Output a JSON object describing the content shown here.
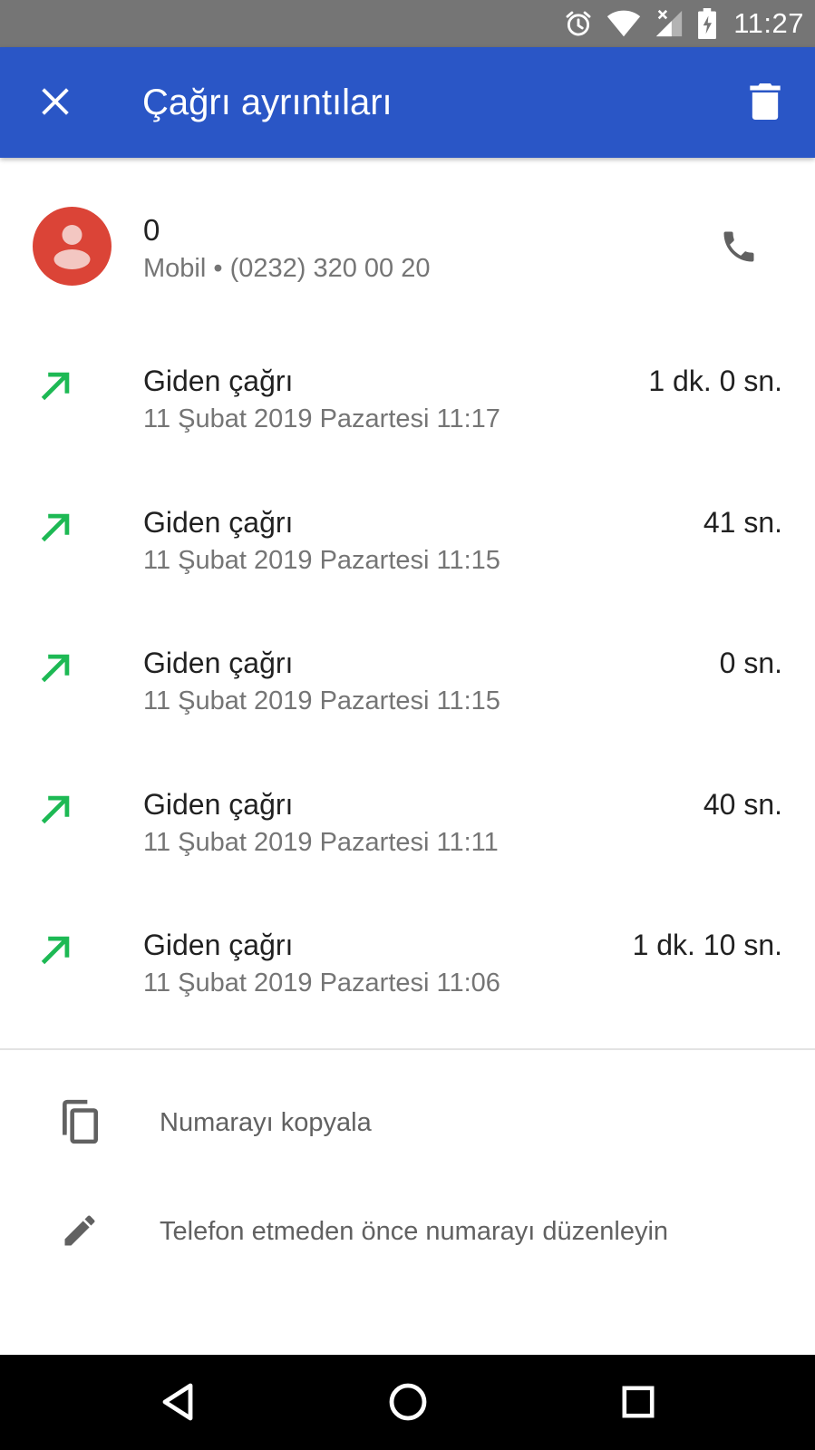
{
  "status_bar": {
    "time": "11:27",
    "icons": [
      "alarm-icon",
      "wifi-icon",
      "signal-icon",
      "battery-charging-icon"
    ]
  },
  "app_bar": {
    "title": "Çağrı ayrıntıları",
    "close_icon": "close-icon",
    "delete_icon": "trash-icon",
    "background": "#2a56c6"
  },
  "contact": {
    "name": "0",
    "subtitle": "Mobil • (0232) 320 00 20",
    "avatar_color": "#db4437",
    "call_icon": "phone-icon"
  },
  "calls": [
    {
      "type": "Giden çağrı",
      "date": "11 Şubat 2019 Pazartesi 11:17",
      "duration": "1 dk. 0 sn."
    },
    {
      "type": "Giden çağrı",
      "date": "11 Şubat 2019 Pazartesi 11:15",
      "duration": "41 sn."
    },
    {
      "type": "Giden çağrı",
      "date": "11 Şubat 2019 Pazartesi 11:15",
      "duration": "0 sn."
    },
    {
      "type": "Giden çağrı",
      "date": "11 Şubat 2019 Pazartesi 11:11",
      "duration": "40 sn."
    },
    {
      "type": "Giden çağrı",
      "date": "11 Şubat 2019 Pazartesi 11:06",
      "duration": "1 dk. 10 sn."
    }
  ],
  "outgoing_color": "#1db954",
  "actions": {
    "copy_label": "Numarayı kopyala",
    "edit_label": "Telefon etmeden önce numarayı düzenleyin"
  },
  "nav_bar": {
    "buttons": [
      "back-icon",
      "home-icon",
      "recents-icon"
    ]
  }
}
